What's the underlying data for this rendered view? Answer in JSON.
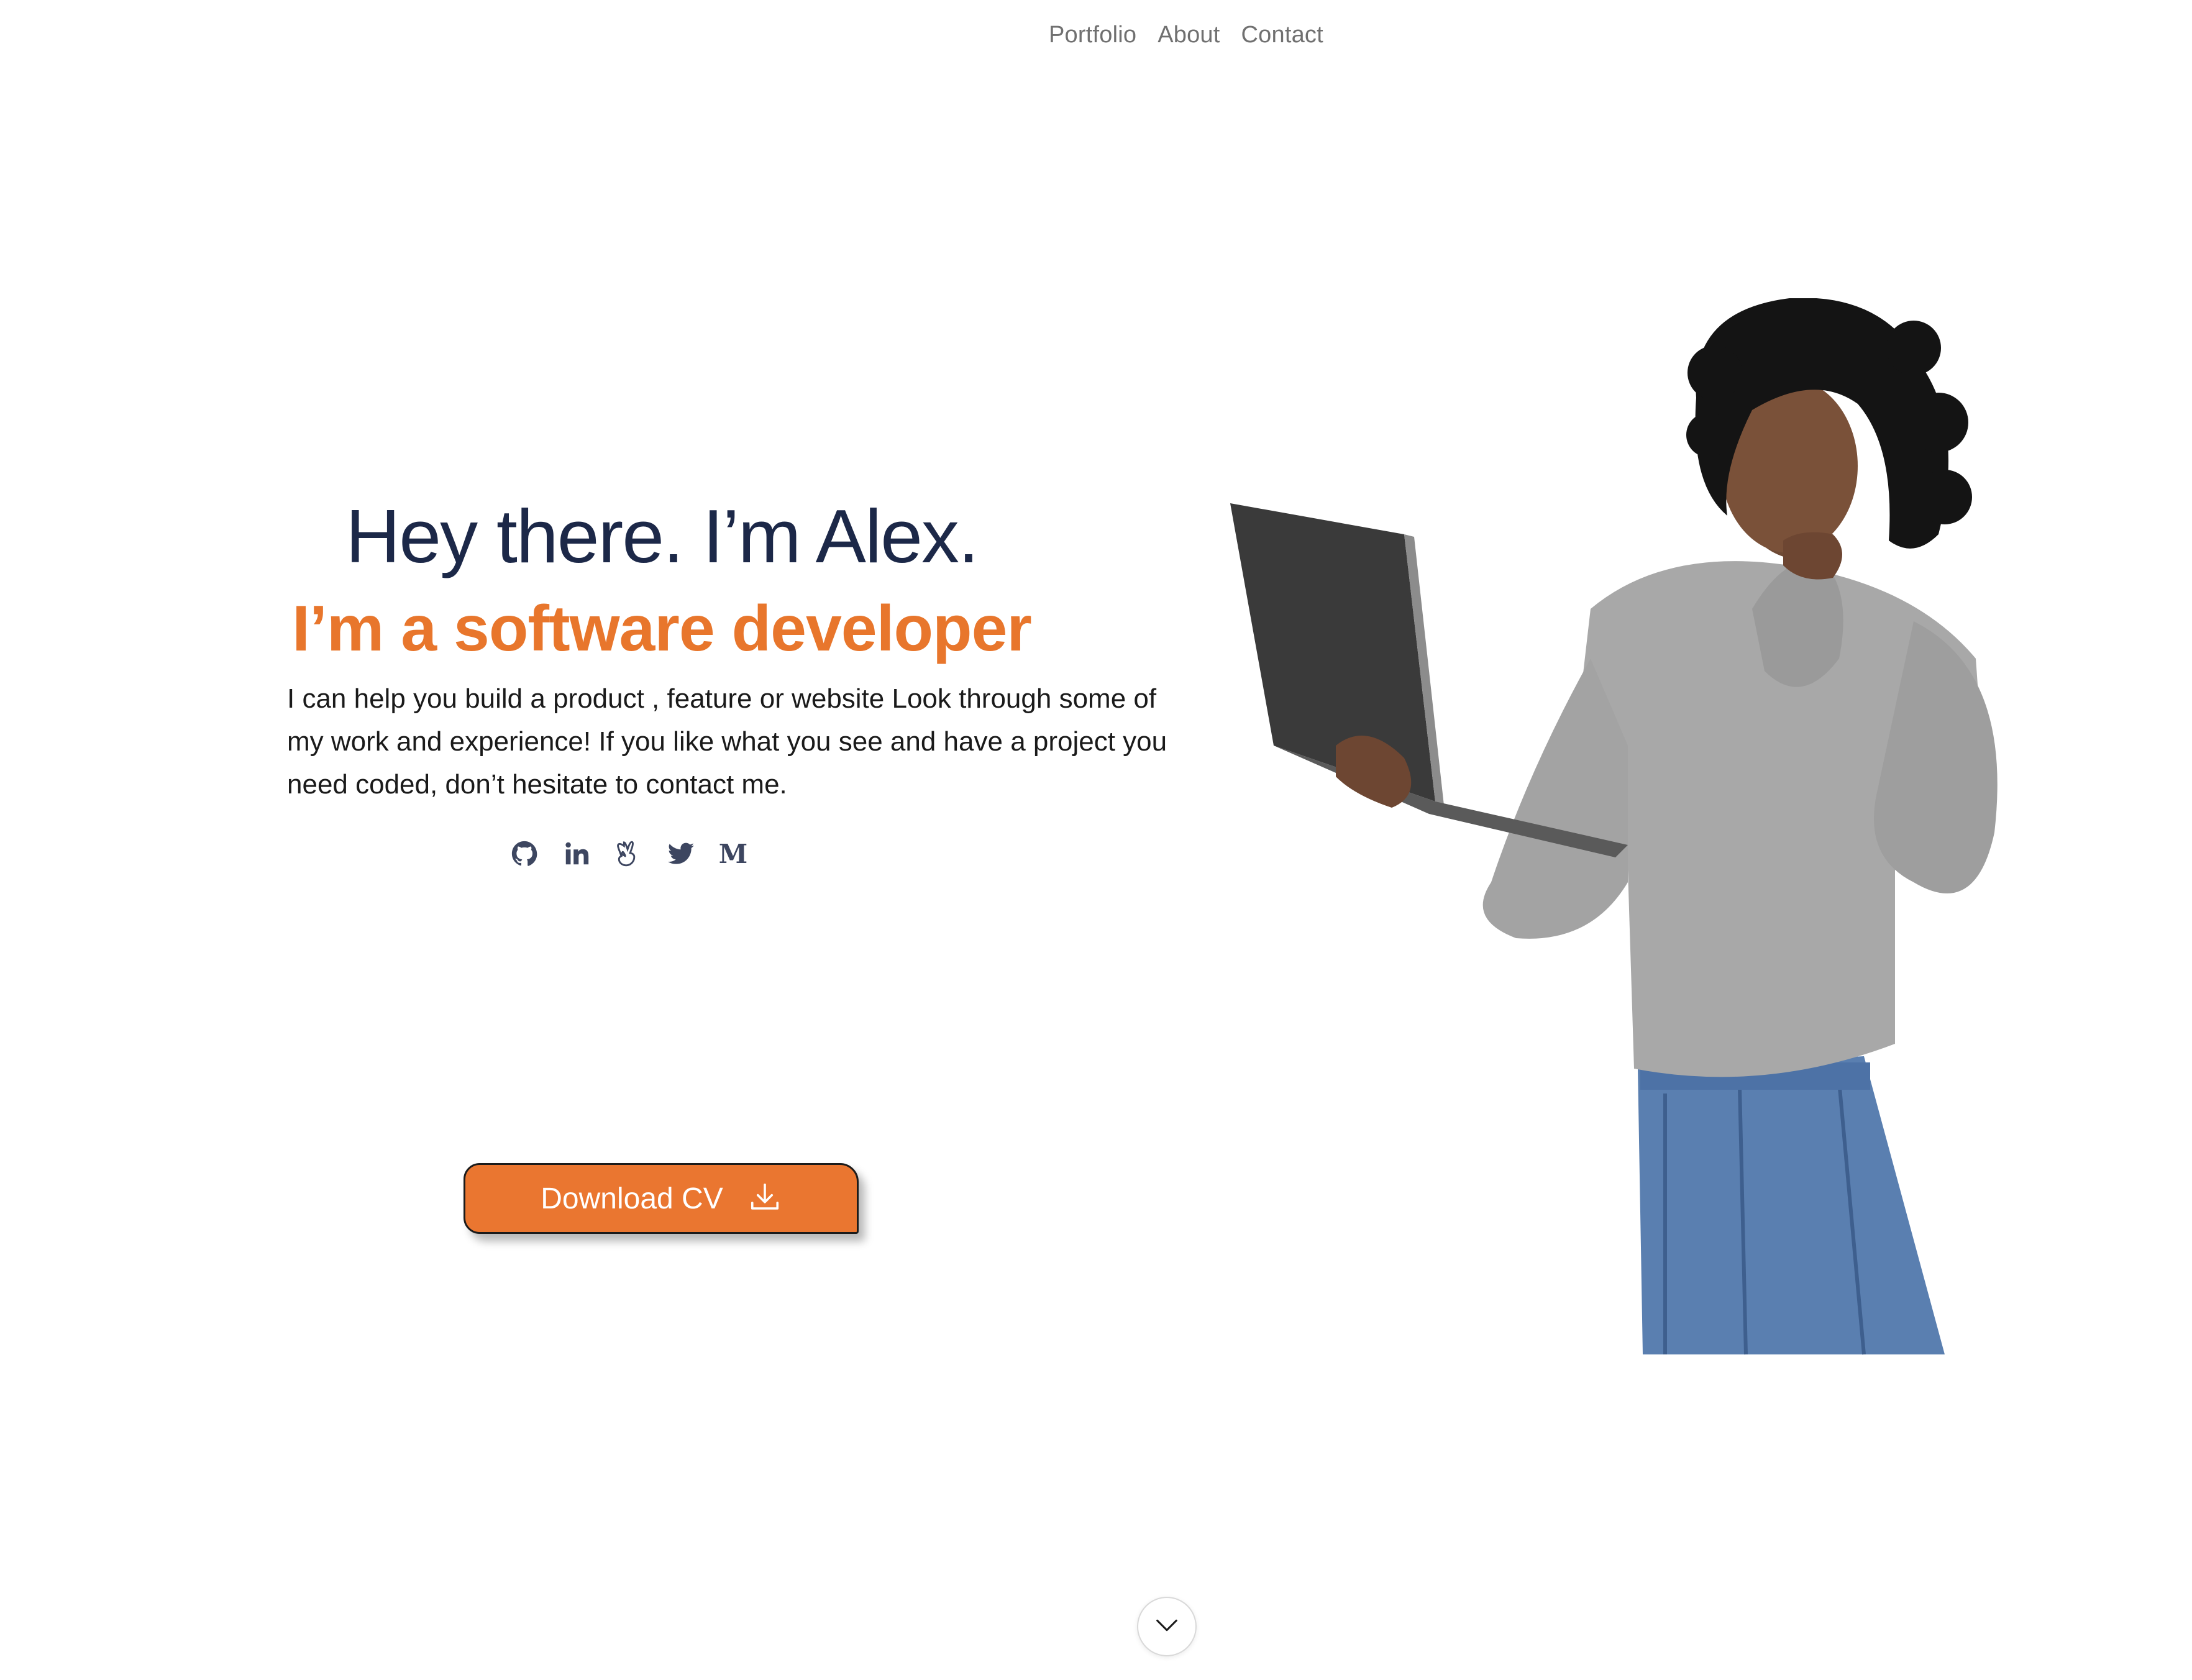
{
  "nav": {
    "items": [
      {
        "label": "Portfolio"
      },
      {
        "label": "About"
      },
      {
        "label": "Contact"
      }
    ]
  },
  "hero": {
    "title": "Hey there. I’m Alex.",
    "subtitle": "I’m a software developer",
    "description": "I can help you build a product , feature or website Look through some of my work and experience! If you like what you see and have a project you need coded, don’t hesitate to contact me."
  },
  "socials": [
    {
      "icon": "github-icon"
    },
    {
      "icon": "linkedin-icon"
    },
    {
      "icon": "angellist-icon"
    },
    {
      "icon": "twitter-icon"
    },
    {
      "icon": "medium-icon",
      "glyph": "M"
    }
  ],
  "download": {
    "label": "Download CV",
    "icon": "download-icon"
  },
  "scroll": {
    "icon": "chevron-down-icon"
  },
  "colors": {
    "title": "#1c2848",
    "accent": "#e8762c",
    "nav_text": "#707070",
    "body_text": "#1a1a1a",
    "icon": "#3d4660"
  }
}
